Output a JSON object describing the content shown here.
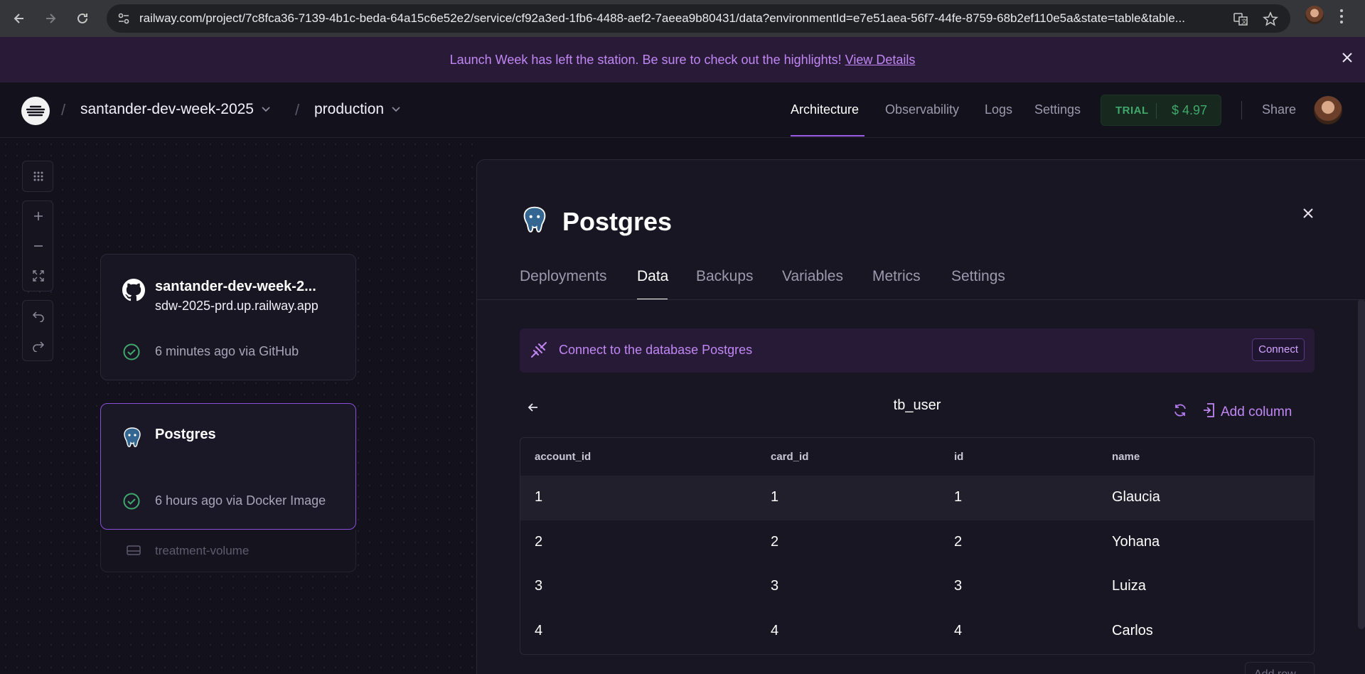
{
  "browser": {
    "url": "railway.com/project/7c8fca36-7139-4b1c-beda-64a15c6e52e2/service/cf92a3ed-1fb6-4488-aef2-7aeea9b80431/data?environmentId=e7e51aea-56f7-44fe-8759-68b2ef110e5a&state=table&table..."
  },
  "banner": {
    "text": "Launch Week has left the station. Be sure to check out the highlights!",
    "link": "View Details"
  },
  "topnav": {
    "project": "santander-dev-week-2025",
    "environment": "production",
    "links": [
      "Architecture",
      "Observability",
      "Logs",
      "Settings"
    ],
    "trial_label": "TRIAL",
    "trial_amount": "$ 4.97",
    "share": "Share"
  },
  "canvas": {
    "services": [
      {
        "title": "santander-dev-week-2...",
        "subtitle": "sdw-2025-prd.up.railway.app",
        "status": "6 minutes ago via GitHub",
        "icon": "github-icon"
      },
      {
        "title": "Postgres",
        "subtitle": "",
        "status": "6 hours ago via Docker Image",
        "icon": "postgres-icon"
      }
    ],
    "volume": "treatment-volume"
  },
  "panel": {
    "title": "Postgres",
    "tabs": [
      "Deployments",
      "Data",
      "Backups",
      "Variables",
      "Metrics",
      "Settings"
    ],
    "active_tab": "Data",
    "connect_text": "Connect to the database Postgres",
    "connect_button": "Connect",
    "table_name": "tb_user",
    "add_column": "Add column",
    "add_row": "Add row",
    "columns": [
      "account_id",
      "card_id",
      "id",
      "name"
    ],
    "rows": [
      [
        "1",
        "1",
        "1",
        "Glaucia"
      ],
      [
        "2",
        "2",
        "2",
        "Yohana"
      ],
      [
        "3",
        "3",
        "3",
        "Luiza"
      ],
      [
        "4",
        "4",
        "4",
        "Carlos"
      ]
    ]
  },
  "colors": {
    "accent": "#c087f5",
    "background": "#13111c",
    "panel": "#181622",
    "success": "#3fa86b"
  }
}
